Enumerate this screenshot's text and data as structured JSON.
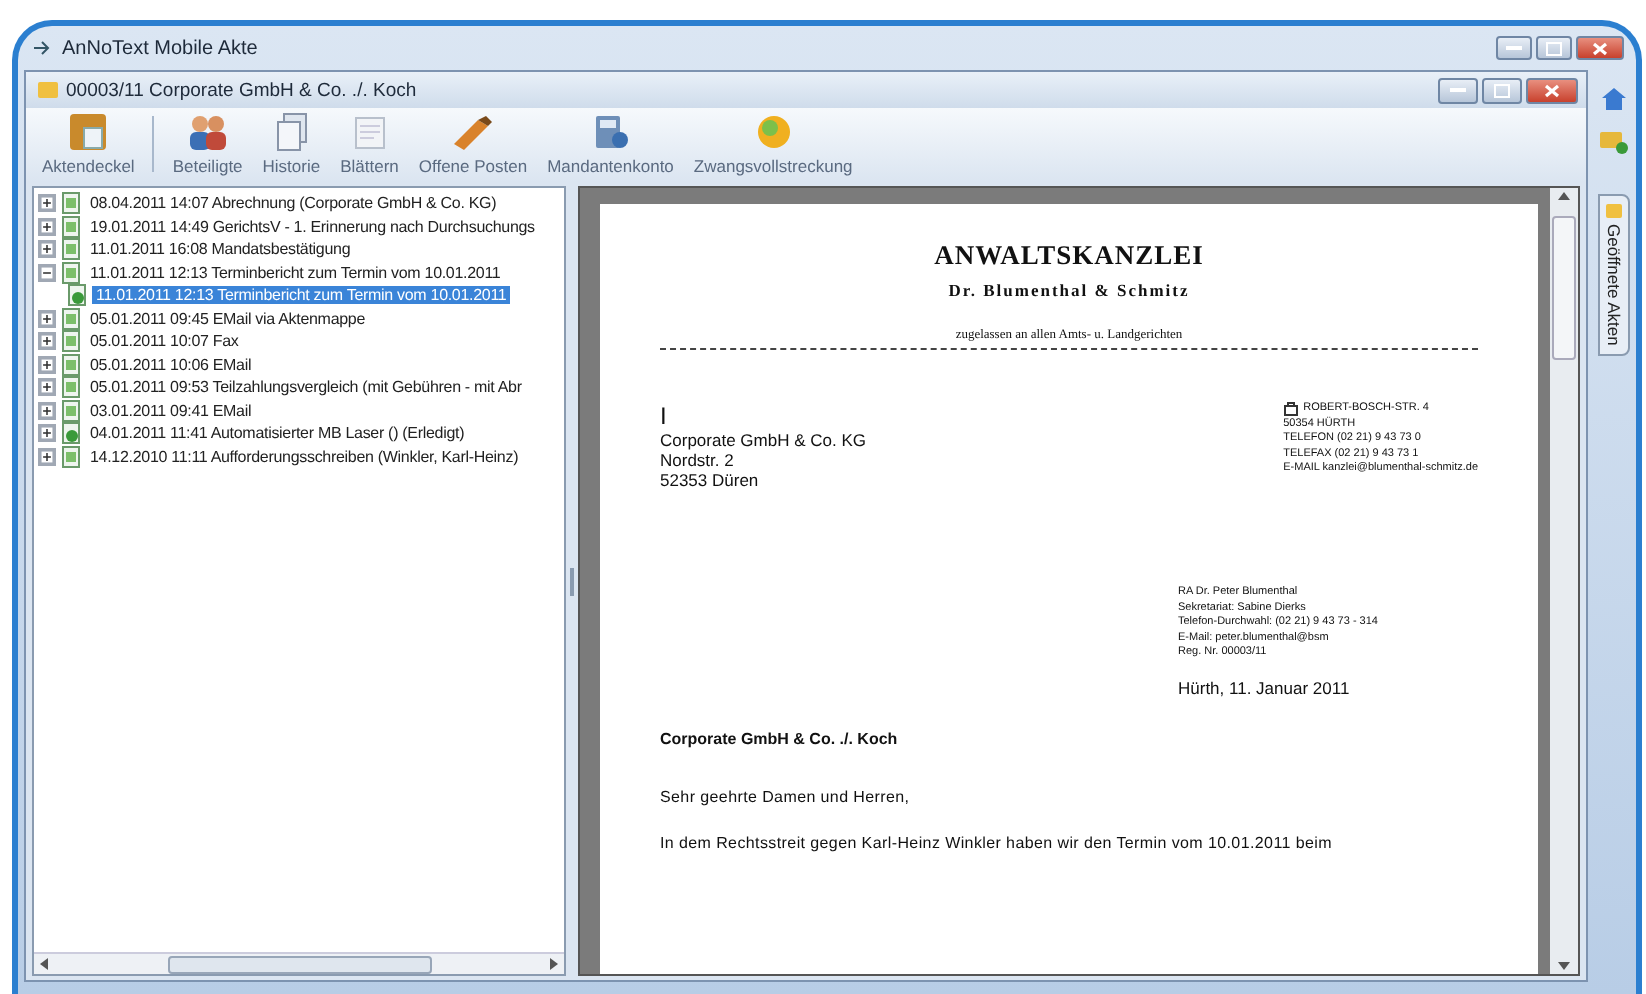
{
  "window": {
    "title": "AnNoText Mobile Akte"
  },
  "document_window": {
    "title": "00003/11  Corporate GmbH & Co. ./. Koch"
  },
  "toolbar": [
    {
      "label": "Aktendeckel",
      "kind": "cover"
    },
    {
      "label": "Beteiligte",
      "kind": "people"
    },
    {
      "label": "Historie",
      "kind": "history"
    },
    {
      "label": "Blättern",
      "kind": "pages"
    },
    {
      "label": "Offene Posten",
      "kind": "open-items"
    },
    {
      "label": "Mandantenkonto",
      "kind": "account"
    },
    {
      "label": "Zwangsvollstreckung",
      "kind": "enforcement"
    }
  ],
  "tree": [
    {
      "text": "08.04.2011 14:07 Abrechnung (Corporate GmbH & Co. KG)",
      "expanded": false,
      "selected": false
    },
    {
      "text": "19.01.2011 14:49 GerichtsV - 1. Erinnerung nach Durchsuchungs",
      "expanded": false,
      "selected": false
    },
    {
      "text": "11.01.2011 16:08 Mandatsbestätigung",
      "expanded": false,
      "selected": false
    },
    {
      "text": "11.01.2011 12:13 Terminbericht zum Termin vom 10.01.2011",
      "expanded": true,
      "selected": false,
      "children": [
        {
          "text": "11.01.2011 12:13 Terminbericht zum Termin vom 10.01.2011",
          "selected": true
        }
      ]
    },
    {
      "text": "05.01.2011 09:45 EMail via Aktenmappe",
      "expanded": false,
      "selected": false
    },
    {
      "text": "05.01.2011 10:07 Fax",
      "expanded": false,
      "selected": false
    },
    {
      "text": "05.01.2011 10:06 EMail",
      "expanded": false,
      "selected": false
    },
    {
      "text": "05.01.2011 09:53 Teilzahlungsvergleich (mit Gebühren - mit Abr",
      "expanded": false,
      "selected": false
    },
    {
      "text": "03.01.2011 09:41 EMail",
      "expanded": false,
      "selected": false
    },
    {
      "text": "04.01.2011 11:41 Automatisierter MB Laser () (Erledigt)",
      "expanded": false,
      "selected": false
    },
    {
      "text": "14.12.2010 11:11 Aufforderungsschreiben (Winkler, Karl-Heinz)",
      "expanded": false,
      "selected": false
    }
  ],
  "letter": {
    "heading": "ANWALTSKANZLEI",
    "firm": "Dr. Blumenthal & Schmitz",
    "admission": "zugelassen an allen Amts- u. Landgerichten",
    "cursor": "I",
    "recipient": [
      "Corporate GmbH & Co. KG",
      "Nordstr. 2",
      "52353 Düren"
    ],
    "address": [
      "ROBERT-BOSCH-STR. 4",
      "50354 HÜRTH",
      "TELEFON (02 21) 9 43 73 0",
      "TELEFAX (02 21) 9 43 73 1",
      "E-MAIL kanzlei@blumenthal-schmitz.de"
    ],
    "contact": [
      "RA Dr. Peter Blumenthal",
      "Sekretariat:  Sabine Dierks",
      "Telefon-Durchwahl:  (02 21) 9 43 73 - 314",
      "E-Mail: peter.blumenthal@bsm",
      "Reg. Nr. 00003/11"
    ],
    "date": "Hürth, 11. Januar 2011",
    "subject": "Corporate GmbH & Co. ./. Koch",
    "salutation": "Sehr geehrte Damen und Herren,",
    "body": "In dem Rechtsstreit gegen Karl-Heinz Winkler haben wir den Termin vom 10.01.2011 beim"
  },
  "side_panel": {
    "tab": "Geöffnete Akten"
  }
}
